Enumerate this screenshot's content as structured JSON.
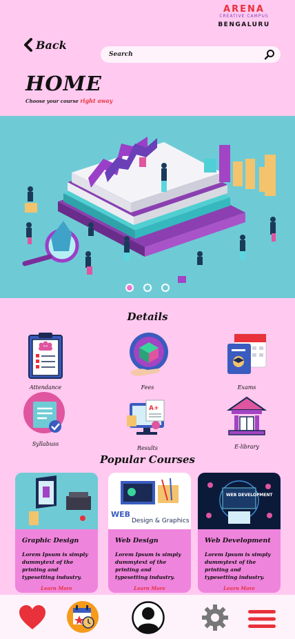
{
  "brand": {
    "logo": "ARENA",
    "tagline": "CREATIVE CAMPUS",
    "city": "BENGALURU"
  },
  "header": {
    "back_label": "Back",
    "search_placeholder": "Search"
  },
  "page": {
    "title": "HOME",
    "subtitle_prefix": "Choose your course ",
    "subtitle_accent": "right away"
  },
  "carousel": {
    "slides": 3,
    "active_index": 0
  },
  "details": {
    "title": "Details",
    "items": [
      {
        "label": "Attendance",
        "icon": "clipboard-icon"
      },
      {
        "label": "Fees",
        "icon": "fees-box-icon"
      },
      {
        "label": "Exams",
        "icon": "exam-calendar-icon"
      },
      {
        "label": "Syllabuss",
        "icon": "syllabus-document-icon"
      },
      {
        "label": "Results",
        "icon": "results-monitor-icon"
      },
      {
        "label": "E-library",
        "icon": "library-building-icon"
      }
    ]
  },
  "popular": {
    "title": "Popular Courses",
    "courses": [
      {
        "title": "Graphic Design",
        "description": "Lorem Ipsum is simply dummytext of the printing and typesetting industry.",
        "link": "Learn More"
      },
      {
        "title": "Web Design",
        "description": "Lorem Ipsum is simply dummytext of the printing and typesetting industry.",
        "link": "Learn More",
        "image_text_1": "WEB",
        "image_text_2": "Design & Graphics"
      },
      {
        "title": "Web Development",
        "description": "Lorem Ipsum is simply dummytext of the printing and typesetting industry.",
        "link": "Learn More",
        "image_text": "WEB DEVELOPMENT"
      }
    ]
  },
  "colors": {
    "background": "#ffc9f0",
    "accent": "#e8313a",
    "card": "#ef84dd",
    "hero": "#6ecbd6",
    "nav_bar": "#fff3fb"
  },
  "nav": {
    "items": [
      "heart-icon",
      "calendar-icon",
      "profile-icon",
      "settings-icon",
      "menu-icon"
    ]
  }
}
